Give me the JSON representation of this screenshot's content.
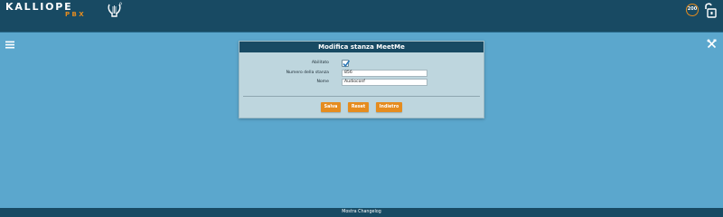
{
  "header": {
    "logo_text": "KALLIOPE",
    "logo_sub": "PBX",
    "badge_text": "200",
    "icons": {
      "lyre": "lyre-logo-icon",
      "logout": "logout-lock-icon",
      "menu": "hamburger-icon",
      "tools": "tools-icon"
    }
  },
  "panel": {
    "title": "Modifica stanza MeetMe",
    "fields": {
      "enabled_label": "Abilitato",
      "enabled_checked": true,
      "room_label": "Numero della stanza",
      "room_value": "856",
      "name_label": "Nome",
      "name_value": "Audioconf"
    },
    "buttons": {
      "save": "Salva",
      "reset": "Reset",
      "back": "Indietro"
    }
  },
  "footer": {
    "text": "Mostra Changelog"
  },
  "colors": {
    "header_bg": "#184a63",
    "page_bg": "#5ba7cd",
    "accent": "#e58c1f",
    "panel_bg": "#bed6de"
  }
}
